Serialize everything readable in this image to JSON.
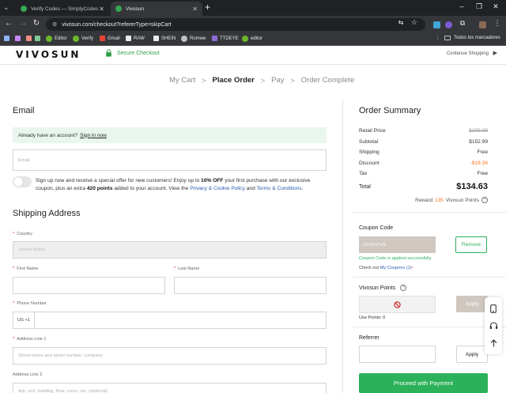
{
  "browser": {
    "tabs": [
      {
        "title": "Verify Codes — SimplyCodes",
        "favicon_color": "#34a853",
        "active": false
      },
      {
        "title": "Vivosun",
        "favicon_color": "#34a853",
        "active": true
      }
    ],
    "url": "vivosun.com/checkout?refererType=skipCart",
    "bookmarks": [
      {
        "label": "Editor",
        "icon": "green-check-icon",
        "color": "#6ab82a"
      },
      {
        "label": "Verify",
        "icon": "green-check-icon",
        "color": "#6ab82a"
      },
      {
        "label": "Gmail",
        "icon": "gmail-icon",
        "color": "#ea4335"
      },
      {
        "label": "RAW",
        "icon": "raw-icon",
        "color": "#e8eaed"
      },
      {
        "label": "SHEIN",
        "icon": "shein-icon",
        "color": "#e8eaed"
      },
      {
        "label": "Romwe",
        "icon": "romwe-icon",
        "color": "#bdc1c6"
      },
      {
        "label": "TTDEYE",
        "icon": "ttdeye-icon",
        "color": "#8e6ad8"
      },
      {
        "label": "editor",
        "icon": "green-check-icon",
        "color": "#6ab82a"
      }
    ],
    "bookmarks_folder": "Todos los marcadores"
  },
  "header": {
    "logo": "VIVOSUN",
    "secure": "Secure Checkout",
    "continue": "Contenue Shopping"
  },
  "steps": {
    "items": [
      "My Cart",
      "Place Order",
      "Pay",
      "Order Complete"
    ],
    "current": "Place Order",
    "separator": ">"
  },
  "email_section": {
    "heading": "Email",
    "account_prompt": "Already have an account?",
    "sign_in": "Sign in now",
    "email_placeholder": "Email",
    "promo_1": "Sign up now and receive a special offer for new customers! Enjoy up to ",
    "promo_bold_1": "10% OFF",
    "promo_2": " your first purchase with our exclusive coupon, plus an extra ",
    "promo_bold_2": "420 points",
    "promo_3": " added to your account. View the ",
    "privacy_link": "Privacy & Cookie Policy",
    "promo_and": " and ",
    "terms_link": "Terms & Conditions",
    "promo_end": ".",
    "subscribe_on": false
  },
  "shipping": {
    "heading": "Shipping Address",
    "country_label": "Country",
    "country_value": "United States",
    "first_name_label": "First Name",
    "last_name_label": "Last Name",
    "phone_label": "Phone Number",
    "phone_code": "US +1",
    "address1_label": "Address Line 1",
    "address1_placeholder": "Street name and street number, company",
    "address2_label": "Address Line 2",
    "address2_placeholder": "Apt, unit, building, floor, room, etc. (optional)"
  },
  "summary": {
    "heading": "Order Summary",
    "rows": [
      {
        "label": "Retail Price",
        "value": "$209.99"
      },
      {
        "label": "Subtotal",
        "value": "$152.99"
      },
      {
        "label": "Shipping",
        "value": "Free"
      },
      {
        "label": "Discount",
        "value": "-$18.36"
      },
      {
        "label": "Tax",
        "value": "Free"
      }
    ],
    "total_label": "Total",
    "total_value": "$134.63",
    "reward_prefix": "Reward",
    "reward_points": "135",
    "reward_suffix": "Vivosun Points",
    "discount_color": "#f47321"
  },
  "coupon": {
    "heading": "Coupon Code",
    "code": "12TENTVS",
    "remove": "Remove",
    "applied_msg": "Coupon Code is applied successfully.",
    "checkout_prefix": "Check out",
    "my_coupons": "My Coupons (1)",
    "dot": "•"
  },
  "points": {
    "heading": "Vivosun Points",
    "apply": "Apply",
    "use_points": "Use Points: 0"
  },
  "referrer": {
    "heading": "Referrer",
    "apply": "Apply"
  },
  "proceed": "Proceed with Payment",
  "colors": {
    "accent_green": "#2bb159",
    "info_bg": "#e8f6ee"
  }
}
